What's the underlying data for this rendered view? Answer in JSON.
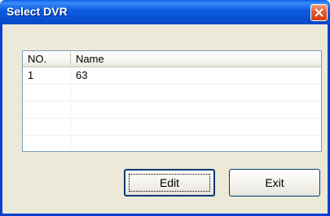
{
  "window": {
    "title": "Select DVR",
    "close_icon": "close-icon"
  },
  "list": {
    "columns": [
      "NO.",
      "Name"
    ],
    "rows": [
      {
        "no": "1",
        "name": "63"
      }
    ]
  },
  "buttons": {
    "edit_label": "Edit",
    "exit_label": "Exit"
  },
  "colors": {
    "titlebar": "#0a4fd4",
    "client_bg": "#ece9d8",
    "close_button": "#e45a2c"
  }
}
